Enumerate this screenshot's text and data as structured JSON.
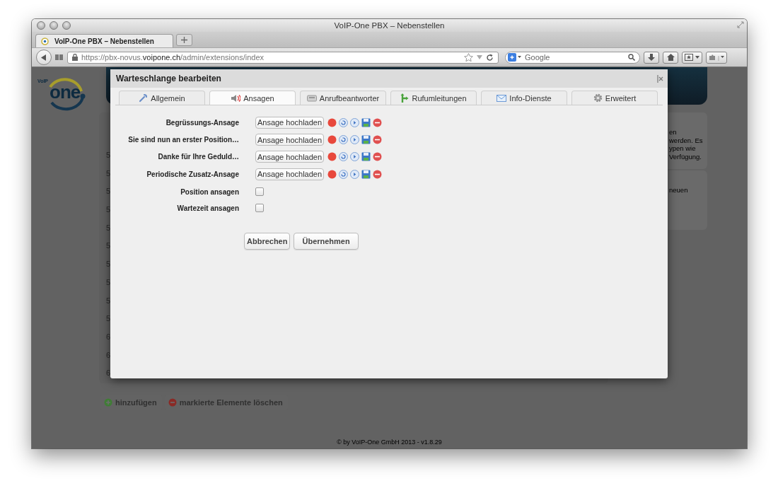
{
  "window": {
    "title": "VoIP-One PBX – Nebenstellen"
  },
  "browser_tabs": [
    {
      "label": "VoIP-One PBX – Nebenstellen",
      "selected": true
    }
  ],
  "address_bar": {
    "url": "https://pbx-novus.**voipone.ch**/admin/extensions/index"
  },
  "search": {
    "placeholder": "Google"
  },
  "page": {
    "logo": {
      "text": "one",
      "small": "VoIP"
    },
    "table_rows": [
      "5",
      "5",
      "5",
      "5",
      "5",
      "5",
      "5",
      "5",
      "5",
      "5",
      "6",
      "6",
      "6"
    ],
    "info_panels": [
      {
        "lines": [
          "en",
          "werden. Es",
          "ypen wie",
          "Verfügung."
        ]
      },
      {
        "lines": [
          "neuen"
        ]
      }
    ],
    "actions": [
      {
        "label": "hinzufügen",
        "kind": "add"
      },
      {
        "label": "markierte Elemente löschen",
        "kind": "delete"
      }
    ],
    "footer": "© by VoIP-One GmbH 2013 - v1.8.29"
  },
  "dialog": {
    "title": "Warteschlange bearbeiten",
    "tabs": [
      {
        "label": "Allgemein",
        "selected": false
      },
      {
        "label": "Ansagen",
        "selected": true
      },
      {
        "label": "Anrufbeantworter",
        "selected": false
      },
      {
        "label": "Rufumleitungen",
        "selected": false
      },
      {
        "label": "Info-Dienste",
        "selected": false
      },
      {
        "label": "Erweitert",
        "selected": false
      }
    ],
    "announcements": [
      {
        "label": "Begrüssungs-Ansage",
        "button": "Ansage hochladen"
      },
      {
        "label": "Sie sind nun an erster Position…",
        "button": "Ansage hochladen"
      },
      {
        "label": "Danke für Ihre Geduld…",
        "button": "Ansage hochladen"
      },
      {
        "label": "Periodische Zusatz-Ansage",
        "button": "Ansage hochladen"
      }
    ],
    "options": [
      {
        "label": "Position ansagen",
        "checked": false
      },
      {
        "label": "Wartezeit ansagen",
        "checked": false
      }
    ],
    "buttons": [
      "Abbrechen",
      "Übernehmen"
    ]
  }
}
